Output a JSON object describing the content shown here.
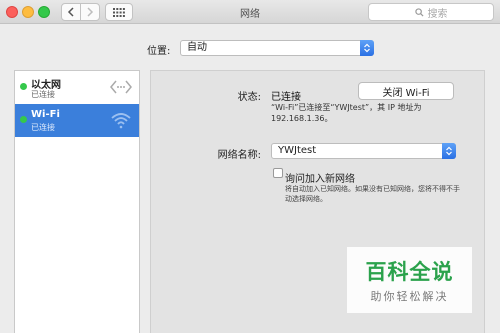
{
  "window": {
    "title": "网络",
    "search_placeholder": "搜索"
  },
  "location": {
    "label": "位置:",
    "value": "自动"
  },
  "services": [
    {
      "name": "以太网",
      "status": "已连接"
    },
    {
      "name": "Wi-Fi",
      "status": "已连接"
    }
  ],
  "detail": {
    "status_label": "状态:",
    "status_value": "已连接",
    "toggle_button": "关闭 Wi-Fi",
    "status_desc_line1": "“Wi-Fi”已连接至“YWJtest”，其 IP 地址为",
    "status_desc_line2": "192.168.1.36。",
    "network_label": "网络名称:",
    "network_value": "YWJtest",
    "ask_join_label": "询问加入新网络",
    "ask_join_desc": "将自动加入已知网络。如果没有已知网络，您将不得不手动选择网络。"
  },
  "watermark": {
    "main": "百科全说",
    "sub": "助你轻松解决"
  },
  "colors": {
    "selected": "#3b7fdb",
    "connected": "#35c84b",
    "accent": "#2a70e4",
    "watermark": "#2ba24c"
  },
  "icons": {
    "back": "chevron-left-icon",
    "forward": "chevron-right-icon",
    "grid": "grid-icon",
    "search": "search-icon",
    "ethernet": "ethernet-icon",
    "wifi": "wifi-icon"
  }
}
